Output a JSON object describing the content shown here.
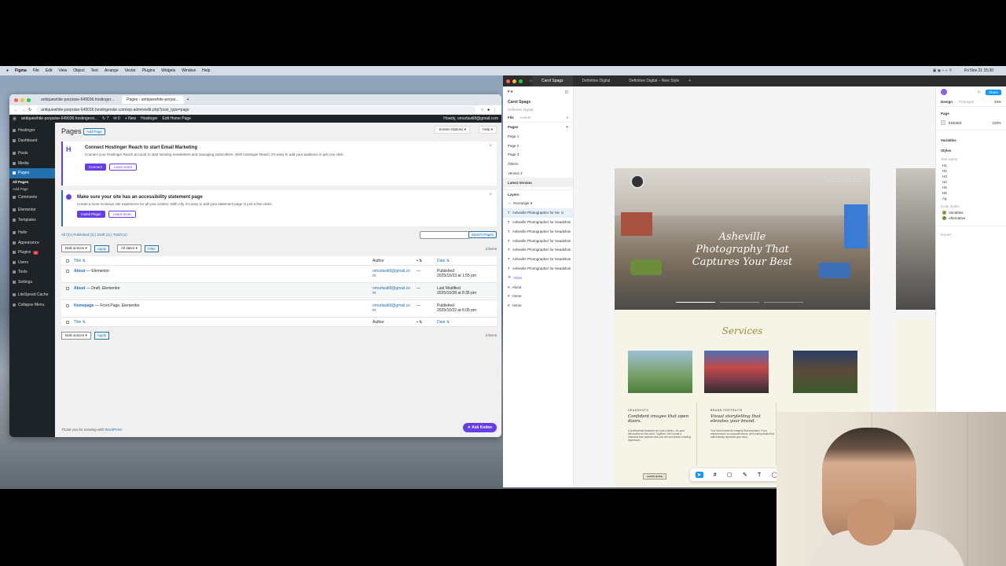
{
  "menubar": {
    "app": "Figma",
    "items": [
      "File",
      "Edit",
      "View",
      "Object",
      "Text",
      "Arrange",
      "Vector",
      "Plugins",
      "Widgets",
      "Window",
      "Help"
    ],
    "clock": "Fri Nov 21  15:30"
  },
  "browser": {
    "tabs": [
      "antiquewhite-porpoise-649036.hostinger...",
      "Pages ‹ antiquewhite-porpoi..."
    ],
    "url": "antiquewhite-porpoise-649036.hostingersite.com/wp-admin/edit.php?post_type=page"
  },
  "wp": {
    "adminbar": {
      "site": "antiquewhite-porpoise-649036.hostingersi...",
      "updates": "7",
      "comments": "0",
      "new": "New",
      "hostinger": "Hostinger",
      "edit": "Edit Home Page",
      "howdy": "Howdy, omurtavili8@gmail.com"
    },
    "sidebar": [
      "Hostinger",
      "Dashboard",
      "Posts",
      "Media",
      "Pages",
      "All Pages",
      "Add Page",
      "Comments",
      "Elementor",
      "Templates",
      "Hello",
      "Appearance",
      "Plugins",
      "Users",
      "Tools",
      "Settings",
      "LiteSpeed Cache",
      "Collapse Menu"
    ],
    "plugins_badge": "6",
    "page_title": "Pages",
    "add_page": "Add Page",
    "screen_options": "Screen Options ▾",
    "help": "Help ▾",
    "notice1": {
      "title": "Connect Hostinger Reach to start Email Marketing",
      "body": "Connect your Hostinger Reach account to start sending newsletters and managing subscribers. With Hostinger Reach, it's easy to add your audience in just one click.",
      "primary": "Connect",
      "secondary": "Learn more"
    },
    "notice2": {
      "title": "Make sure your site has an accessibility statement page",
      "body": "Create a more inclusive site experience for all your visitors. With Ally, it's easy to add your statement page in just a few clicks.",
      "primary": "Install Plugin",
      "secondary": "Learn more"
    },
    "filters": "All (3) | Published (2) | Draft (1) | Trash (1)",
    "bulk": "Bulk actions",
    "apply": "Apply",
    "dates": "All dates",
    "filter": "Filter",
    "search_btn": "Search Pages",
    "items_count": "3 items",
    "headers": {
      "title": "Title",
      "author": "Author",
      "date": "Date"
    },
    "rows": [
      {
        "title": "About",
        "state": "— Elementor",
        "author": "omurtavili8@gmail.com",
        "date1": "Published",
        "date2": "2025/10/23 at 1:55 pm"
      },
      {
        "title": "About",
        "state": "— Draft, Elementor",
        "author": "omurtavili8@gmail.com",
        "date1": "Last Modified",
        "date2": "2025/10/28 at 8:35 pm"
      },
      {
        "title": "Homepage",
        "state": "— Front Page, Elementor",
        "author": "omurtavili8@gmail.com",
        "date1": "Published",
        "date2": "2025/10/22 at 6:05 pm"
      }
    ],
    "dash": "—",
    "footer": "Thank you for creating with",
    "footer_link": "WordPress",
    "ask": "Ask Kodee"
  },
  "figma": {
    "tabs": [
      "Carol Spags",
      "Definitive Digital",
      "Definitive Digital – New Style"
    ],
    "project": "Carol Spags",
    "subtitle": "Definitive Digital",
    "file_tab": "File",
    "assets_tab": "Assets",
    "pages_label": "Pages",
    "pages": [
      "Page 1",
      "Page 2",
      "Page 3",
      "Others",
      "Version 2",
      "Latest Version"
    ],
    "layers_label": "Layers",
    "layers": [
      "Rectangle 8",
      "Asheville Photographer for Headshots...",
      "Asheville Photographer for Headshots...",
      "Asheville Photographer for Headshots...",
      "Asheville Photographer for Headshots...",
      "Asheville Photographer for Headshots...",
      "Asheville Photographer for Headshots...",
      "Asheville Photographer for Headshots...",
      "Slider",
      "About",
      "Home",
      "Home"
    ],
    "right": {
      "design": "Design",
      "prototype": "Prototype",
      "zoom": "33%",
      "page": "Page",
      "color": "E5E5E5",
      "opacity": "100%",
      "variables": "Variables",
      "styles": "Styles",
      "text_styles": "Text styles",
      "styles_list": [
        "H1",
        "H2",
        "H3",
        "H4",
        "H5",
        "H6",
        "Ag"
      ],
      "color_styles": "Color styles",
      "colors": [
        "Variables",
        "Alternative"
      ],
      "export": "Export",
      "share": "Share"
    },
    "hero_title": "Asheville Photography That Captures Your Best",
    "services": "Services",
    "card1": {
      "tag": "HEADSHOTS",
      "title": "Confident images that open doors.",
      "body": "A professional headshot isn't just a photo—it's your introduction to the world. Together, we'll create a headshot that captures who you are and leaves a lasting impression."
    },
    "card2": {
      "tag": "BRAND PORTRAITS",
      "title": "Visual storytelling that elevates your brand.",
      "body": "Your brand deserves imagery that resonates. From entrepreneurs to corporate teams, we'll craft portraits that authentically represent your story."
    },
    "cta": "LEARN MORE"
  },
  "colors": {
    "wp_accent": "#673de6",
    "wp_link": "#2271b1",
    "figma_gold": "#a58a3a"
  }
}
